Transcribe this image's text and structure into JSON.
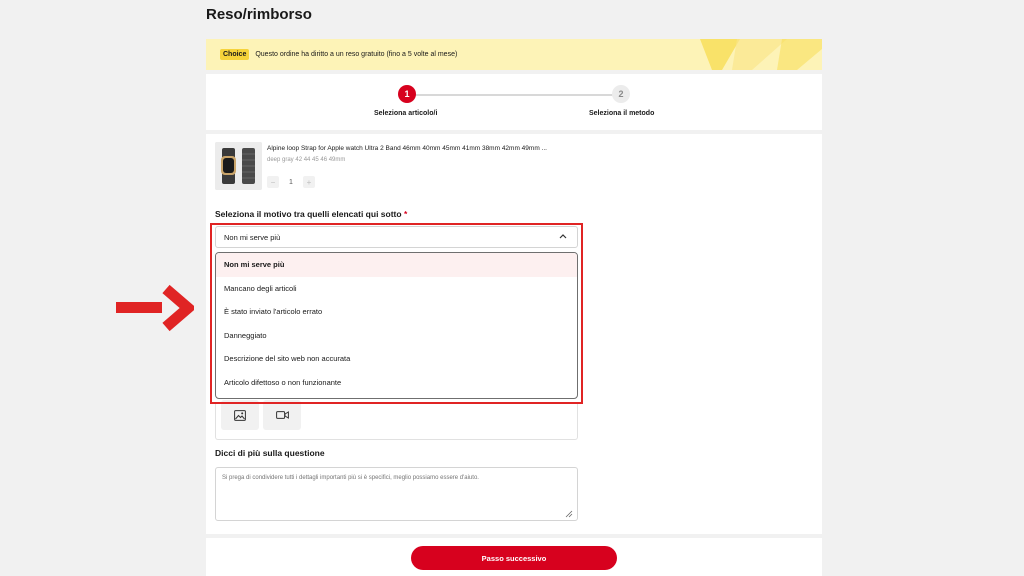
{
  "page": {
    "title": "Reso/rimborso"
  },
  "banner": {
    "badge": "Choice",
    "text": "Questo ordine ha diritto a un reso gratuito (fino a 5 volte al mese)"
  },
  "stepper": {
    "steps": [
      {
        "number": "1",
        "label": "Seleziona articolo/i"
      },
      {
        "number": "2",
        "label": "Seleziona il metodo"
      }
    ]
  },
  "product": {
    "title": "Alpine loop Strap for Apple watch Ultra 2 Band 46mm 40mm 45mm 41mm 38mm 42mm 49mm ...",
    "variant": "deep gray 42 44 45 46 49mm",
    "quantity": "1",
    "decrement": "−",
    "increment": "+"
  },
  "reason": {
    "label": "Seleziona il motivo tra quelli elencati qui sotto",
    "required_mark": "*",
    "selected": "Non mi serve più",
    "options": [
      "Non mi serve più",
      "Mancano degli articoli",
      "È stato inviato l'articolo errato",
      "Danneggiato",
      "Descrizione del sito web non accurata",
      "Articolo difettoso o non funzionante"
    ]
  },
  "details": {
    "label": "Dicci di più sulla questione",
    "placeholder": "Si prega di condividere tutti i dettagli importanti più si è specifici, meglio possiamo essere d'aiuto."
  },
  "footer": {
    "next_label": "Passo successivo"
  },
  "colors": {
    "accent": "#d7011e",
    "highlight": "#e02424",
    "banner_bg": "#fdf3b7"
  }
}
